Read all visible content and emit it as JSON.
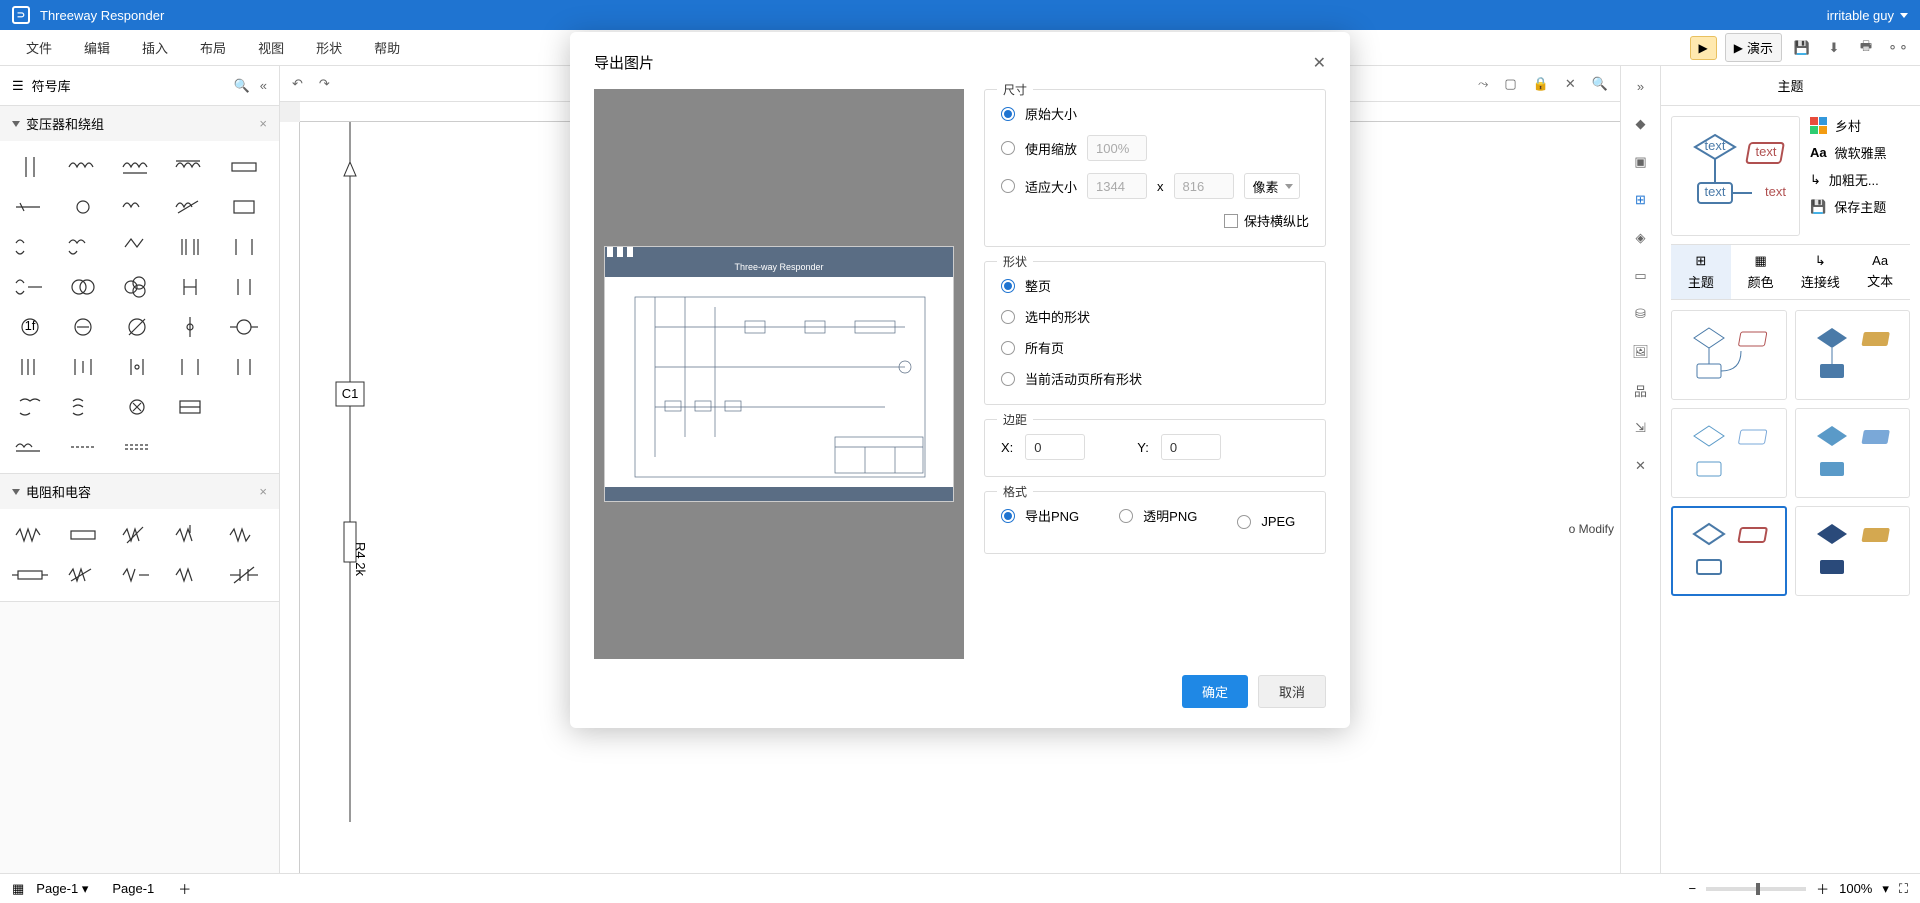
{
  "app": {
    "title": "Threeway Responder",
    "user": "irritable guy"
  },
  "menu": [
    "文件",
    "编辑",
    "插入",
    "布局",
    "视图",
    "形状",
    "帮助"
  ],
  "menuActions": {
    "present": "演示"
  },
  "symbolLib": {
    "title": "符号库",
    "sections": [
      {
        "name": "变压器和绕组"
      },
      {
        "name": "电阻和电容"
      }
    ]
  },
  "rightPanel": {
    "title": "主题",
    "opts": {
      "village": "乡村",
      "font": "微软雅黑",
      "bold": "加粗无...",
      "save": "保存主题"
    },
    "tabs": [
      "主题",
      "颜色",
      "连接线",
      "文本"
    ]
  },
  "status": {
    "pageSelector": "Page-1",
    "pageTab": "Page-1",
    "zoom": "100%"
  },
  "canvas": {
    "c1": "C1",
    "r4": "R4 2k",
    "modifyLabel": "o Modify"
  },
  "modal": {
    "title": "导出图片",
    "previewTitle": "Three-way Responder",
    "size": {
      "legend": "尺寸",
      "original": "原始大小",
      "scale": "使用缩放",
      "scaleValue": "100%",
      "fit": "适应大小",
      "width": "1344",
      "height": "816",
      "unit": "像素",
      "keepRatio": "保持横纵比",
      "x": "x"
    },
    "shape": {
      "legend": "形状",
      "full": "整页",
      "selected": "选中的形状",
      "allPages": "所有页",
      "activeAll": "当前活动页所有形状"
    },
    "margin": {
      "legend": "边距",
      "xLabel": "X:",
      "yLabel": "Y:",
      "xValue": "0",
      "yValue": "0"
    },
    "format": {
      "legend": "格式",
      "png": "导出PNG",
      "transparent": "透明PNG",
      "jpeg": "JPEG"
    },
    "ok": "确定",
    "cancel": "取消"
  }
}
